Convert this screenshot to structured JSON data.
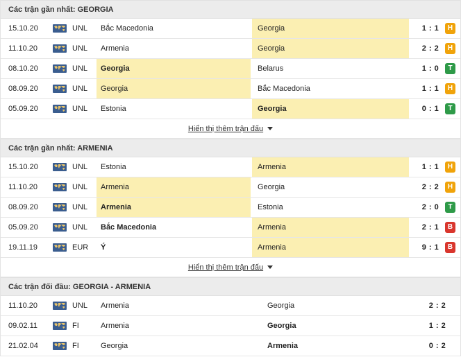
{
  "sections": {
    "georgia": {
      "title": "Các trận gần nhất: GEORGIA",
      "more": "Hiển thị thêm trận đấu",
      "rows": [
        {
          "date": "15.10.20",
          "comp": "UNL",
          "home": "Bắc Macedonia",
          "away": "Georgia",
          "score": "1 : 1",
          "result": "H",
          "hl": "away",
          "bold": ""
        },
        {
          "date": "11.10.20",
          "comp": "UNL",
          "home": "Armenia",
          "away": "Georgia",
          "score": "2 : 2",
          "result": "H",
          "hl": "away",
          "bold": ""
        },
        {
          "date": "08.10.20",
          "comp": "UNL",
          "home": "Georgia",
          "away": "Belarus",
          "score": "1 : 0",
          "result": "T",
          "hl": "home",
          "bold": "home"
        },
        {
          "date": "08.09.20",
          "comp": "UNL",
          "home": "Georgia",
          "away": "Bắc Macedonia",
          "score": "1 : 1",
          "result": "H",
          "hl": "home",
          "bold": ""
        },
        {
          "date": "05.09.20",
          "comp": "UNL",
          "home": "Estonia",
          "away": "Georgia",
          "score": "0 : 1",
          "result": "T",
          "hl": "away",
          "bold": "away"
        }
      ]
    },
    "armenia": {
      "title": "Các trận gần nhất: ARMENIA",
      "more": "Hiển thị thêm trận đấu",
      "rows": [
        {
          "date": "15.10.20",
          "comp": "UNL",
          "home": "Estonia",
          "away": "Armenia",
          "score": "1 : 1",
          "result": "H",
          "hl": "away",
          "bold": ""
        },
        {
          "date": "11.10.20",
          "comp": "UNL",
          "home": "Armenia",
          "away": "Georgia",
          "score": "2 : 2",
          "result": "H",
          "hl": "home",
          "bold": ""
        },
        {
          "date": "08.09.20",
          "comp": "UNL",
          "home": "Armenia",
          "away": "Estonia",
          "score": "2 : 0",
          "result": "T",
          "hl": "home",
          "bold": "home"
        },
        {
          "date": "05.09.20",
          "comp": "UNL",
          "home": "Bắc Macedonia",
          "away": "Armenia",
          "score": "2 : 1",
          "result": "B",
          "hl": "away",
          "bold": "home"
        },
        {
          "date": "19.11.19",
          "comp": "EUR",
          "home": "Ý",
          "away": "Armenia",
          "score": "9 : 1",
          "result": "B",
          "hl": "away",
          "bold": "home"
        }
      ]
    },
    "h2h": {
      "title": "Các trận đối đầu: GEORGIA - ARMENIA",
      "rows": [
        {
          "date": "11.10.20",
          "comp": "UNL",
          "home": "Armenia",
          "away": "Georgia",
          "score": "2 : 2",
          "bold": ""
        },
        {
          "date": "09.02.11",
          "comp": "FI",
          "home": "Armenia",
          "away": "Georgia",
          "score": "1 : 2",
          "bold": "away"
        },
        {
          "date": "21.02.04",
          "comp": "FI",
          "home": "Georgia",
          "away": "Armenia",
          "score": "0 : 2",
          "bold": "away"
        }
      ]
    }
  },
  "icons": {
    "competition_flag": "world-map-icon",
    "expand": "caret-down-icon"
  },
  "colors": {
    "highlight": "#fbefb2",
    "draw": "#f0a30a",
    "win": "#2e9a48",
    "loss": "#d9362d",
    "header_bg": "#ececec"
  }
}
